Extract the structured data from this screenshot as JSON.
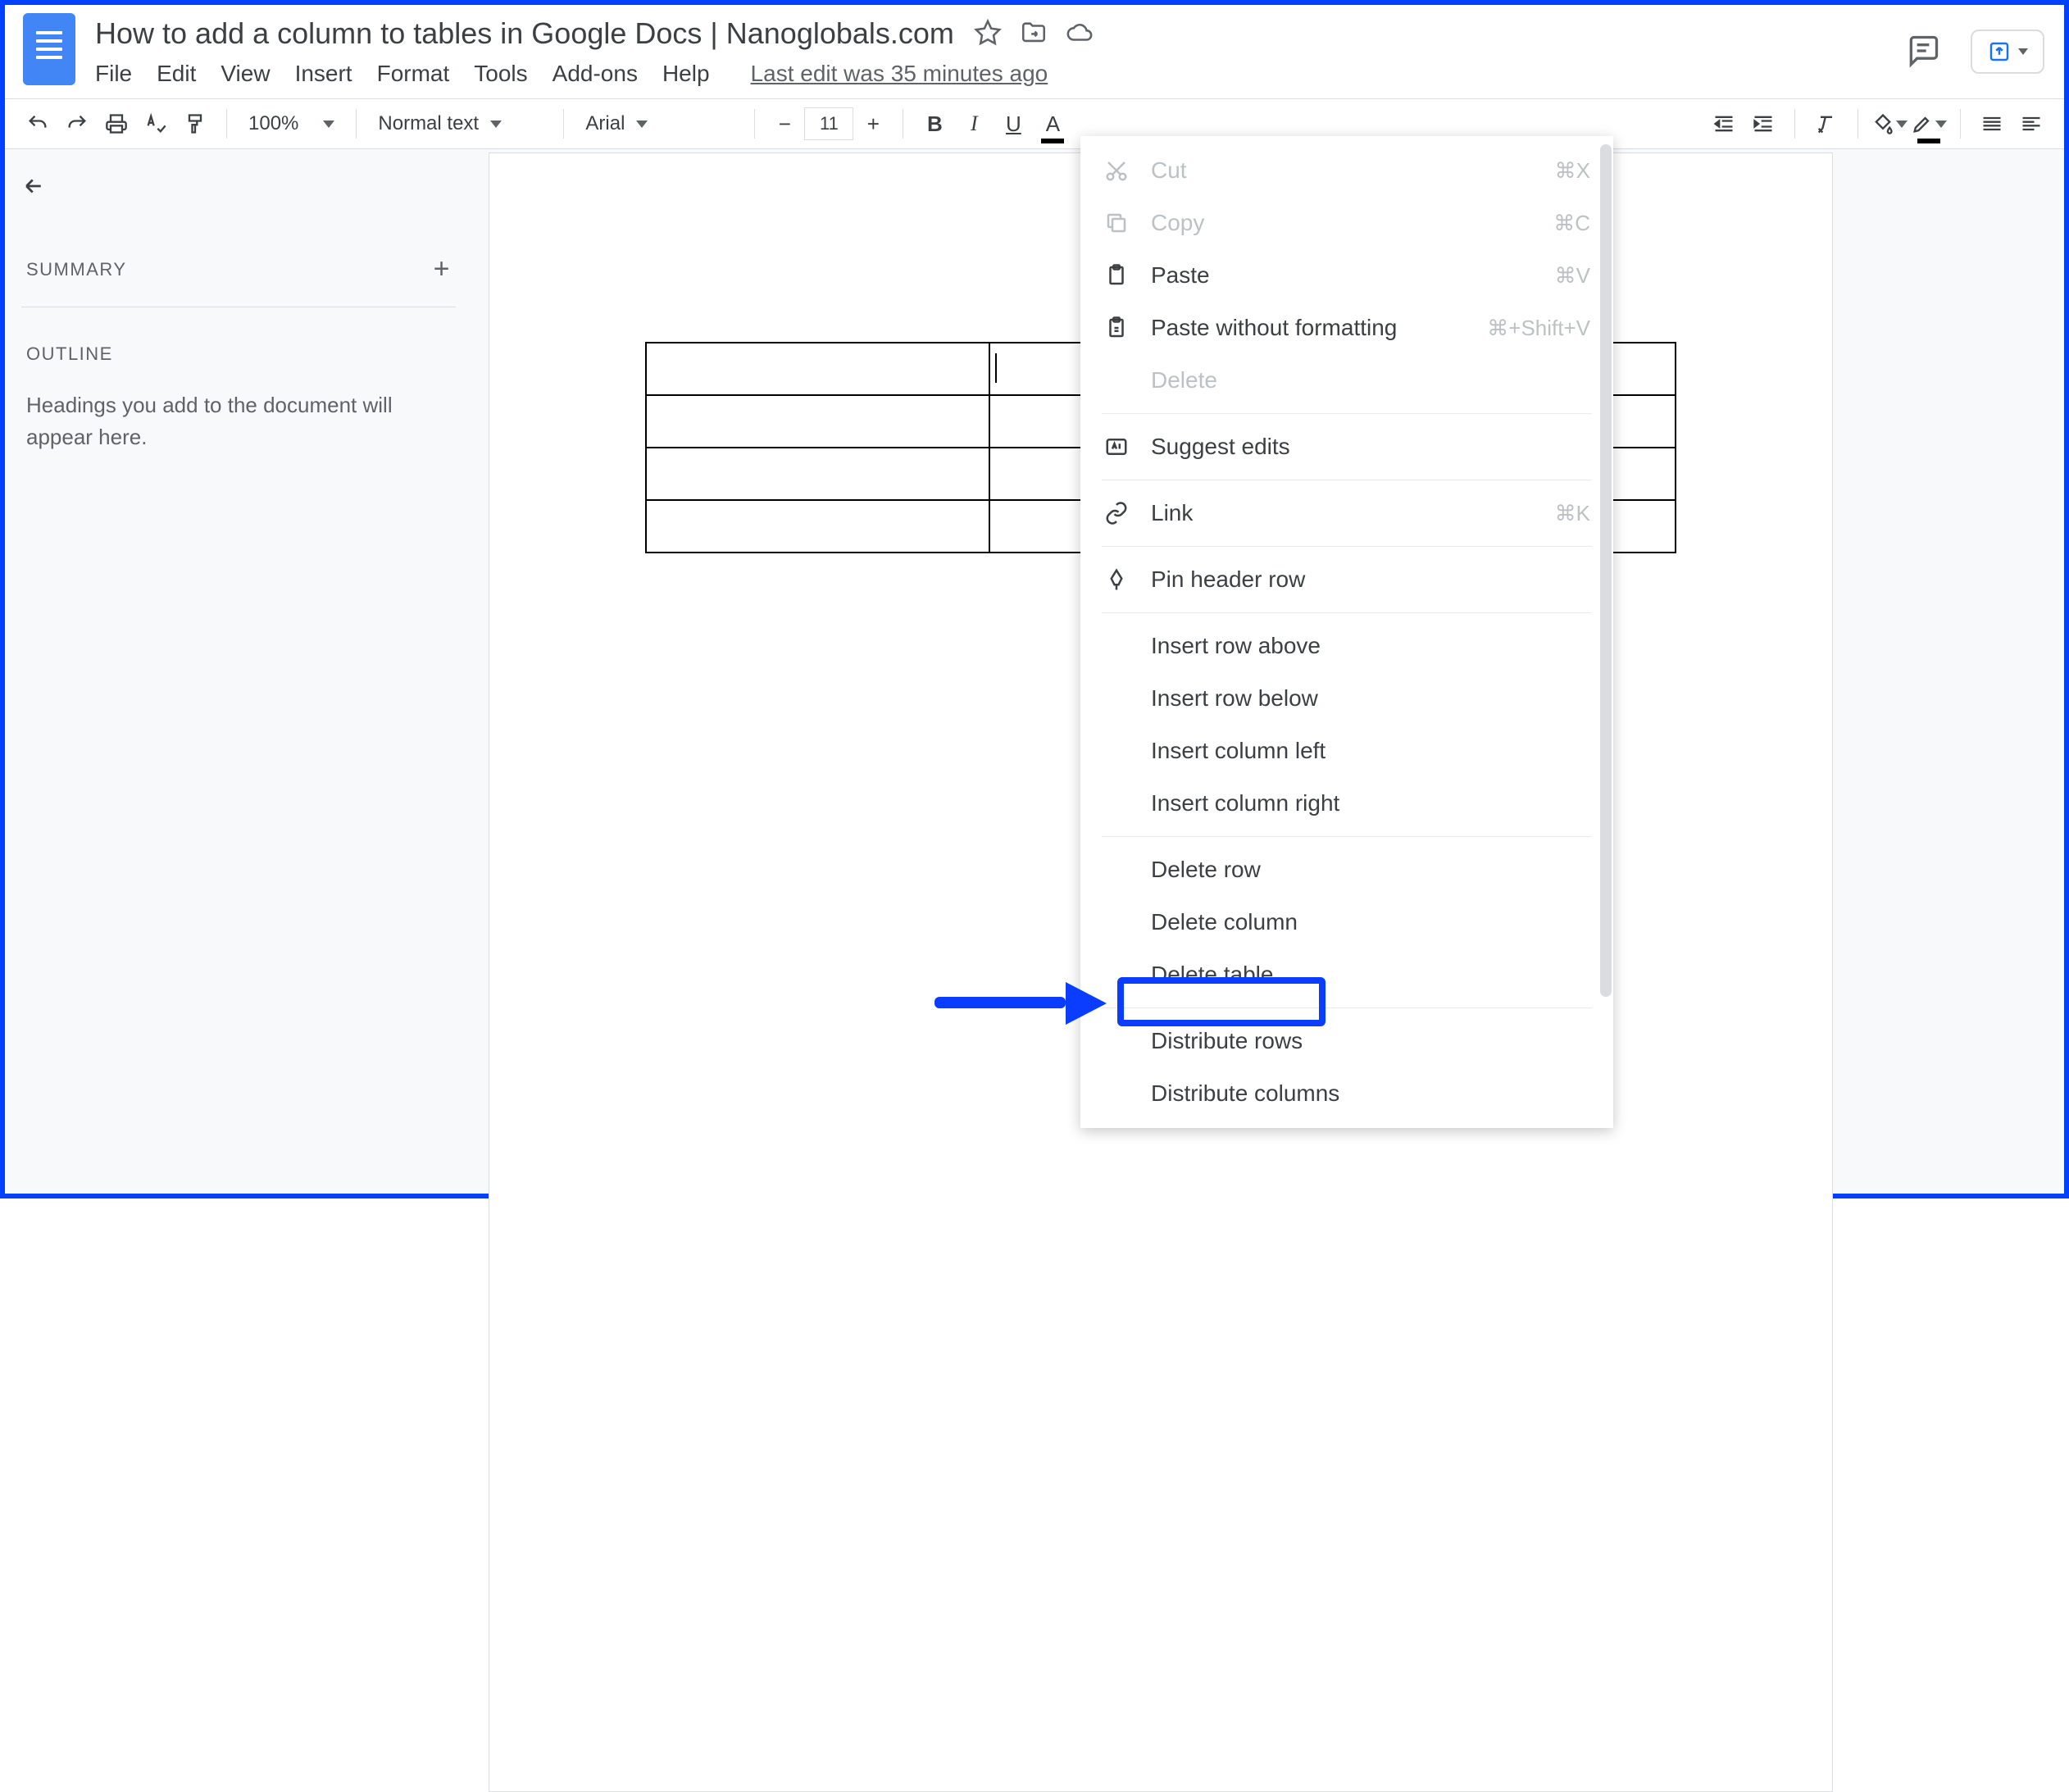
{
  "doc_title": "How to add a column to tables in Google Docs | Nanoglobals.com",
  "menubar": {
    "file": "File",
    "edit": "Edit",
    "view": "View",
    "insert": "Insert",
    "format": "Format",
    "tools": "Tools",
    "addons": "Add-ons",
    "help": "Help",
    "last_edit": "Last edit was 35 minutes ago"
  },
  "toolbar": {
    "zoom": "100%",
    "style": "Normal text",
    "font": "Arial",
    "font_size": "11"
  },
  "sidebar": {
    "summary": "SUMMARY",
    "outline": "OUTLINE",
    "hint": "Headings you add to the document will appear here."
  },
  "ctx": {
    "cut": "Cut",
    "cut_sc": "⌘X",
    "copy": "Copy",
    "copy_sc": "⌘C",
    "paste": "Paste",
    "paste_sc": "⌘V",
    "pastewf": "Paste without formatting",
    "pastewf_sc": "⌘+Shift+V",
    "delete": "Delete",
    "suggest": "Suggest edits",
    "link": "Link",
    "link_sc": "⌘K",
    "pin": "Pin header row",
    "ira": "Insert row above",
    "irb": "Insert row below",
    "icl": "Insert column left",
    "icr": "Insert column right",
    "dr": "Delete row",
    "dc": "Delete column",
    "dt": "Delete table",
    "distr": "Distribute rows",
    "distc": "Distribute columns"
  }
}
